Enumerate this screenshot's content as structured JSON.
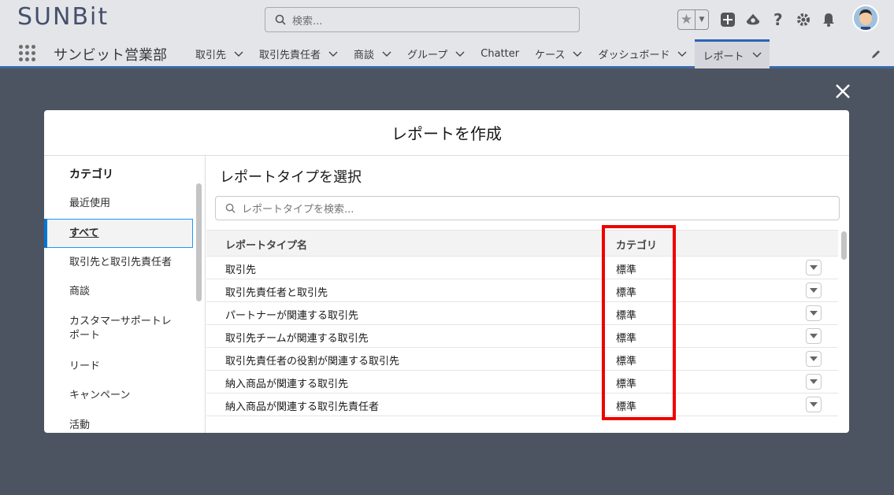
{
  "header": {
    "logo": "SUNBit",
    "search_placeholder": "検索...",
    "icons": [
      "star-icon",
      "add-icon",
      "trailhead-icon",
      "help-icon",
      "gear-icon",
      "bell-icon",
      "avatar"
    ]
  },
  "nav": {
    "app_name": "サンビット営業部",
    "tabs": [
      {
        "label": "取引先",
        "chevron": true
      },
      {
        "label": "取引先責任者",
        "chevron": true
      },
      {
        "label": "商談",
        "chevron": true
      },
      {
        "label": "グループ",
        "chevron": true
      },
      {
        "label": "Chatter",
        "chevron": false
      },
      {
        "label": "ケース",
        "chevron": true
      },
      {
        "label": "ダッシュボード",
        "chevron": true
      },
      {
        "label": "レポート",
        "chevron": true,
        "active": true
      }
    ]
  },
  "modal": {
    "title": "レポートを作成",
    "left": {
      "heading": "カテゴリ",
      "items": [
        {
          "label": "最近使用"
        },
        {
          "label": "すべて",
          "selected": true
        },
        {
          "label": "取引先と取引先責任者"
        },
        {
          "label": "商談"
        },
        {
          "label": "カスタマーサポートレポート"
        },
        {
          "label": "リード"
        },
        {
          "label": "キャンペーン"
        },
        {
          "label": "活動"
        }
      ]
    },
    "right": {
      "heading": "レポートタイプを選択",
      "search_placeholder": "レポートタイプを検索...",
      "columns": [
        "レポートタイプ名",
        "カテゴリ"
      ],
      "rows": [
        {
          "name": "取引先",
          "category": "標準"
        },
        {
          "name": "取引先責任者と取引先",
          "category": "標準"
        },
        {
          "name": "パートナーが関連する取引先",
          "category": "標準"
        },
        {
          "name": "取引先チームが関連する取引先",
          "category": "標準"
        },
        {
          "name": "取引先責任者の役割が関連する取引先",
          "category": "標準"
        },
        {
          "name": "納入商品が関連する取引先",
          "category": "標準"
        },
        {
          "name": "納入商品が関連する取引先責任者",
          "category": "標準"
        }
      ]
    }
  },
  "colors": {
    "highlight": "#ee0000",
    "accent": "#0176d3",
    "overlay": "#4d5461"
  }
}
